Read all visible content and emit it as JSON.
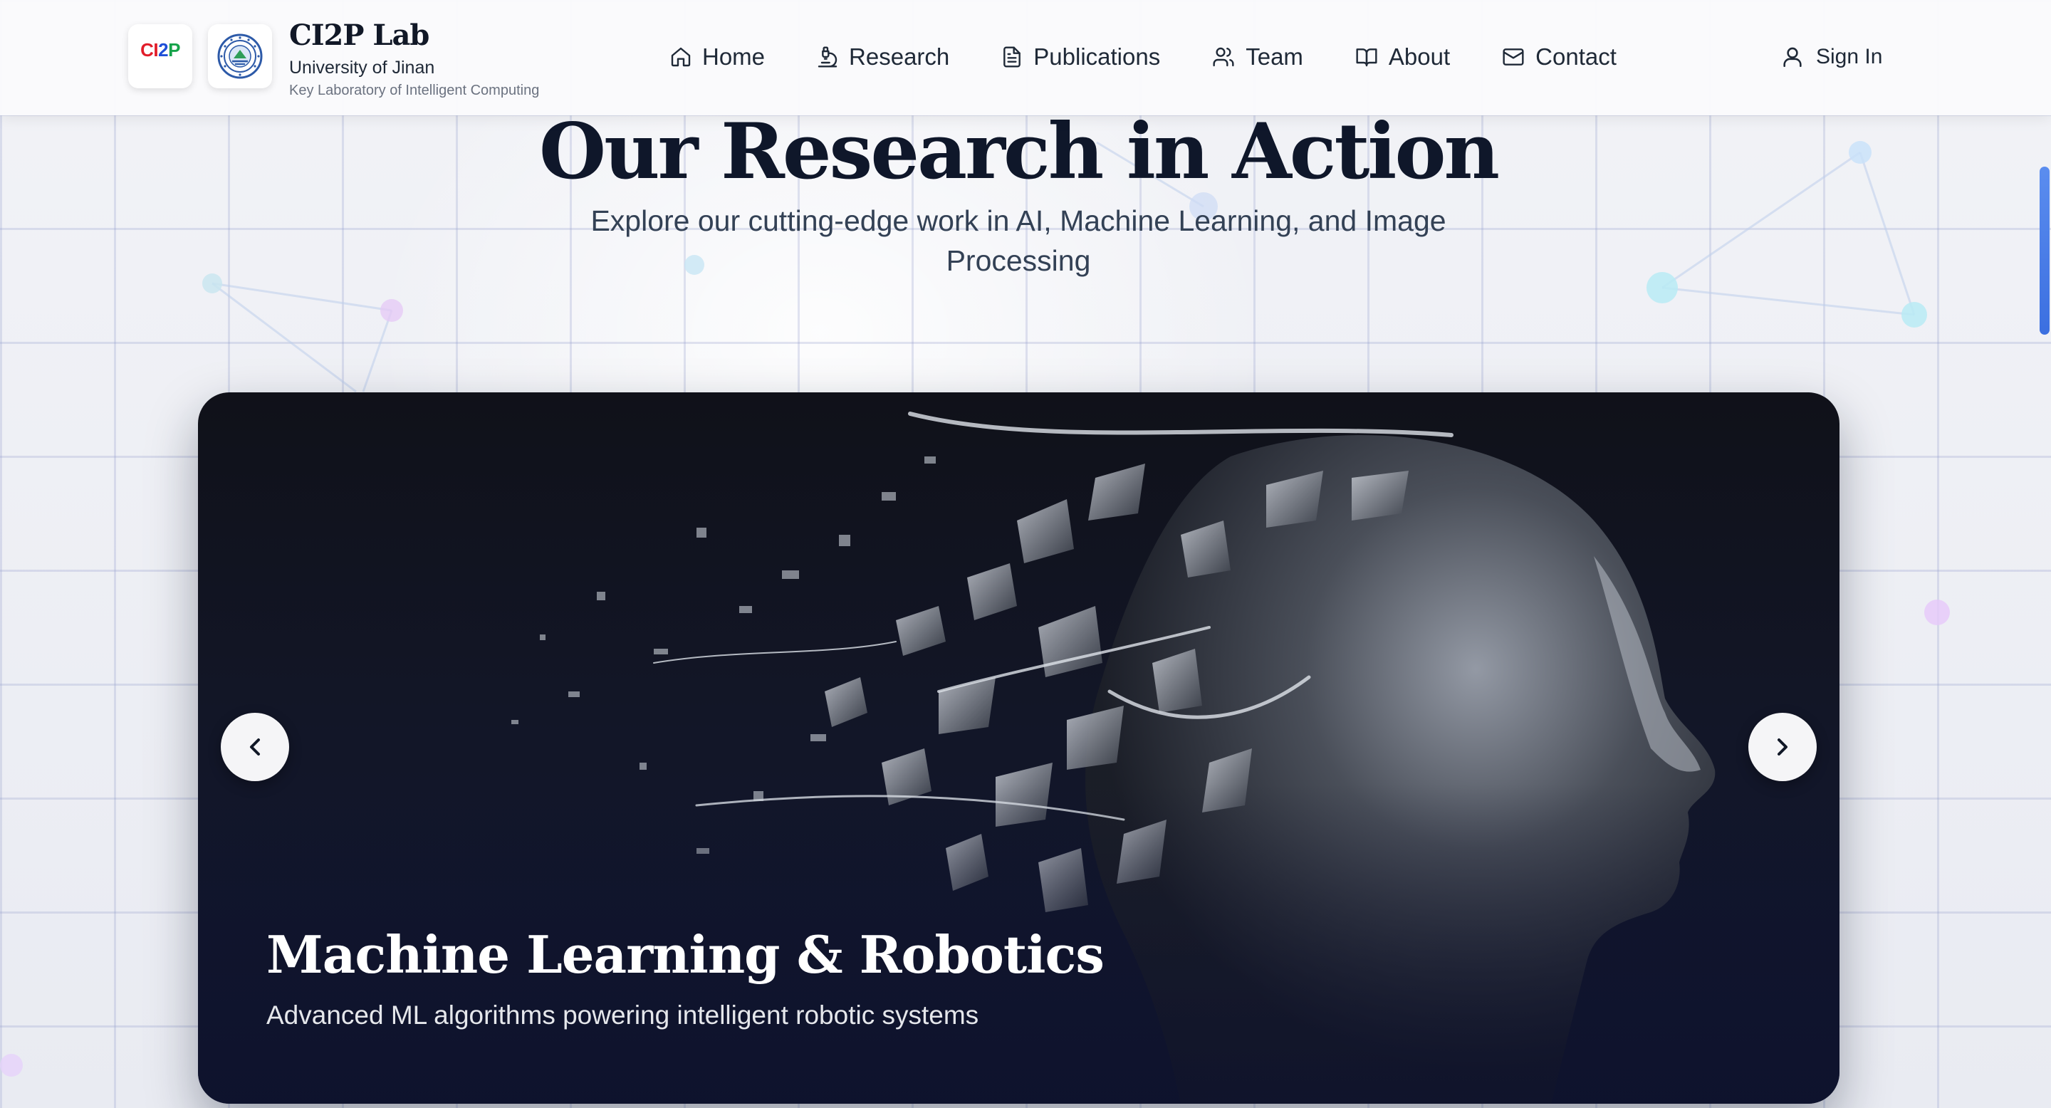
{
  "header": {
    "logo_text_parts": [
      "CI",
      "2",
      "P"
    ],
    "logo_colors": [
      "#e11d2a",
      "#1e4fd8",
      "#16a34a"
    ],
    "brand_title": "CI2P Lab",
    "brand_subtitle": "University of Jinan",
    "brand_tagline": "Key Laboratory of Intelligent Computing",
    "nav": [
      {
        "label": "Home",
        "icon": "home-icon"
      },
      {
        "label": "Research",
        "icon": "microscope-icon"
      },
      {
        "label": "Publications",
        "icon": "document-icon"
      },
      {
        "label": "Team",
        "icon": "users-icon"
      },
      {
        "label": "About",
        "icon": "book-icon"
      },
      {
        "label": "Contact",
        "icon": "mail-icon"
      }
    ],
    "sign_in": {
      "label": "Sign In",
      "icon": "user-icon"
    }
  },
  "hero": {
    "title": "Our Research in Action",
    "subtitle": "Explore our cutting-edge work in AI, Machine Learning, and Image Processing"
  },
  "carousel": {
    "current_slide": {
      "title": "Machine Learning & Robotics",
      "description": "Advanced ML algorithms powering intelligent robotic systems"
    },
    "prev_icon": "chevron-left-icon",
    "next_icon": "chevron-right-icon"
  },
  "colors": {
    "accent_blue": "#3b6fe0",
    "text_dark": "#0f172a",
    "slide_bg": "#111631"
  }
}
